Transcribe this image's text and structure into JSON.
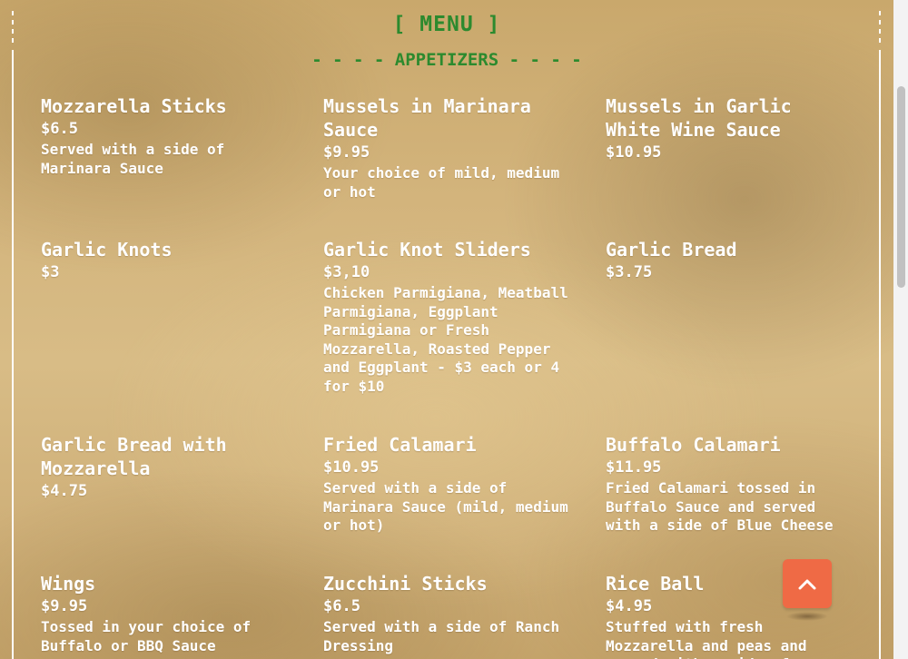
{
  "header": {
    "title": "[ MENU ]",
    "section": "- - - - APPETIZERS - - - -"
  },
  "colors": {
    "heading_green": "#2c8a2e",
    "text": "#ffffff",
    "accent_button": "#ef6a45"
  },
  "items": [
    {
      "name": "Mozzarella Sticks",
      "price": "$6.5",
      "desc": "Served with a side of Marinara Sauce"
    },
    {
      "name": "Mussels in Marinara Sauce",
      "price": "$9.95",
      "desc": "Your choice of mild, medium or hot"
    },
    {
      "name": "Mussels in Garlic White Wine Sauce",
      "price": "$10.95",
      "desc": ""
    },
    {
      "name": "Garlic Knots",
      "price": "$3",
      "desc": ""
    },
    {
      "name": "Garlic Knot Sliders",
      "price": "$3,10",
      "desc": "Chicken Parmigiana, Meatball Parmigiana, Eggplant Parmigiana or Fresh Mozzarella, Roasted Pepper and Eggplant - $3 each or 4 for $10"
    },
    {
      "name": "Garlic Bread",
      "price": "$3.75",
      "desc": ""
    },
    {
      "name": "Garlic Bread with Mozzarella",
      "price": "$4.75",
      "desc": ""
    },
    {
      "name": "Fried Calamari",
      "price": "$10.95",
      "desc": "Served with a side of Marinara Sauce (mild, medium or hot)"
    },
    {
      "name": "Buffalo Calamari",
      "price": "$11.95",
      "desc": "Fried Calamari tossed in Buffalo Sauce and served with a side of Blue Cheese"
    },
    {
      "name": "Wings",
      "price": "$9.95",
      "desc": "Tossed in your choice of Buffalo or BBQ Sauce"
    },
    {
      "name": "Zucchini Sticks",
      "price": "$6.5",
      "desc": "Served with a side of Ranch Dressing"
    },
    {
      "name": "Rice Ball",
      "price": "$4.95",
      "desc": "Stuffed with fresh Mozzarella and peas and served with a side of"
    }
  ],
  "scroll_top_button": {
    "icon": "chevron-up-icon"
  }
}
